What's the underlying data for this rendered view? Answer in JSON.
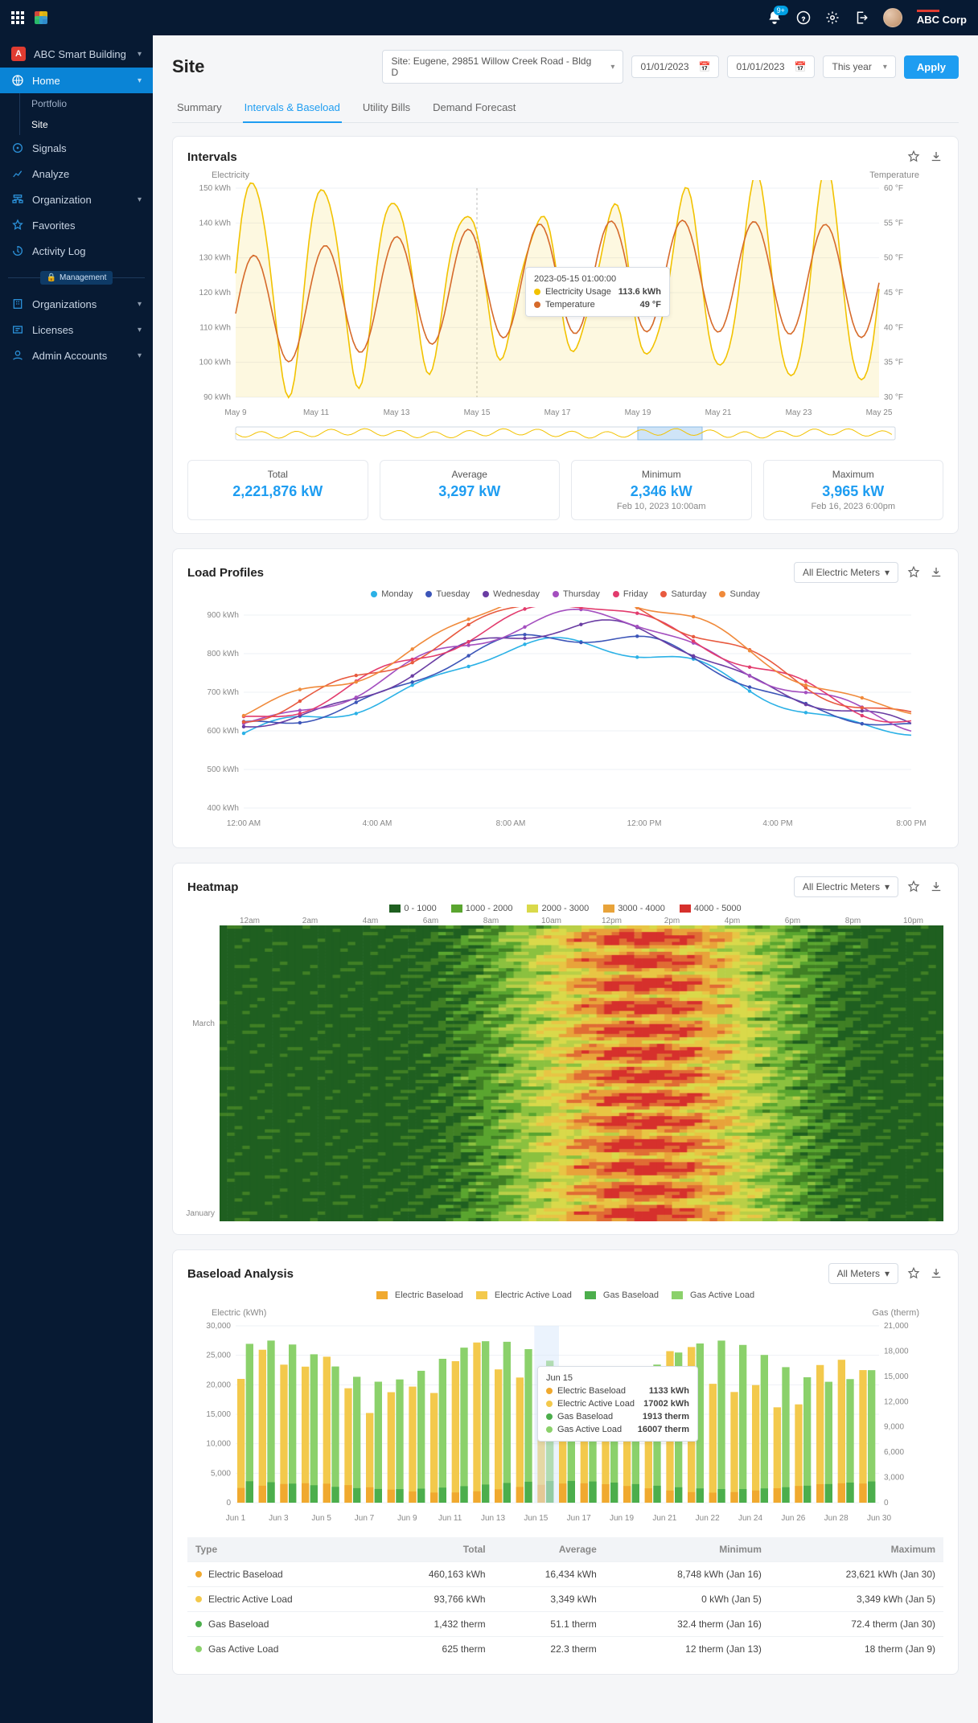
{
  "topbar": {
    "notif_badge": "9+",
    "brand": "ABC Corp"
  },
  "sidebar": {
    "app_name": "ABC Smart Building",
    "home": "Home",
    "sub_portfolio": "Portfolio",
    "sub_site": "Site",
    "signals": "Signals",
    "analyze": "Analyze",
    "organization": "Organization",
    "favorites": "Favorites",
    "activity_log": "Activity Log",
    "management_label": "Management",
    "organizations": "Organizations",
    "licenses": "Licenses",
    "admin_accounts": "Admin Accounts"
  },
  "page": {
    "title": "Site",
    "site_selector": "Site: Eugene, 29851 Willow Creek Road - Bldg D",
    "date_from": "01/01/2023",
    "date_to": "01/01/2023",
    "range": "This year",
    "apply": "Apply"
  },
  "tabs": {
    "summary": "Summary",
    "intervals": "Intervals & Baseload",
    "utility": "Utility Bills",
    "forecast": "Demand Forecast"
  },
  "intervals": {
    "title": "Intervals",
    "left_axis": "Electricity",
    "right_axis": "Temperature",
    "tooltip_time": "2023-05-15 01:00:00",
    "tooltip_elec_label": "Electricity Usage",
    "tooltip_elec_val": "113.6 kWh",
    "tooltip_temp_label": "Temperature",
    "tooltip_temp_val": "49 °F",
    "stats": {
      "total_label": "Total",
      "total_val": "2,221,876 kW",
      "avg_label": "Average",
      "avg_val": "3,297 kW",
      "min_label": "Minimum",
      "min_val": "2,346 kW",
      "min_sub": "Feb 10, 2023 10:00am",
      "max_label": "Maximum",
      "max_val": "3,965 kW",
      "max_sub": "Feb 16, 2023 6:00pm"
    }
  },
  "load_profiles": {
    "title": "Load Profiles",
    "meter_select": "All Electric Meters",
    "legend": {
      "mon": "Monday",
      "tue": "Tuesday",
      "wed": "Wednesday",
      "thu": "Thursday",
      "fri": "Friday",
      "sat": "Saturday",
      "sun": "Sunday"
    }
  },
  "heatmap": {
    "title": "Heatmap",
    "meter_select": "All Electric Meters",
    "legend": {
      "b1": "0 - 1000",
      "b2": "1000 - 2000",
      "b3": "2000 - 3000",
      "b4": "3000 - 4000",
      "b5": "4000 - 5000"
    }
  },
  "baseload": {
    "title": "Baseload Analysis",
    "meter_select": "All Meters",
    "legend": {
      "eb": "Electric Baseload",
      "ea": "Electric Active Load",
      "gb": "Gas Baseload",
      "ga": "Gas Active Load"
    },
    "left_axis": "Electric (kWh)",
    "right_axis": "Gas (therm)",
    "tooltip": {
      "date": "Jun 15",
      "eb_label": "Electric Baseload",
      "eb_val": "1133 kWh",
      "ea_label": "Electric Active Load",
      "ea_val": "17002 kWh",
      "gb_label": "Gas Baseload",
      "gb_val": "1913 therm",
      "ga_label": "Gas Active Load",
      "ga_val": "16007 therm"
    },
    "table": {
      "h_type": "Type",
      "h_total": "Total",
      "h_avg": "Average",
      "h_min": "Minimum",
      "h_max": "Maximum",
      "rows": [
        {
          "type": "Electric Baseload",
          "total": "460,163 kWh",
          "avg": "16,434 kWh",
          "min": "8,748 kWh (Jan 16)",
          "max": "23,621 kWh (Jan 30)",
          "color": "#f0a92f"
        },
        {
          "type": "Electric Active Load",
          "total": "93,766 kWh",
          "avg": "3,349 kWh",
          "min": "0 kWh (Jan 5)",
          "max": "3,349 kWh (Jan 5)",
          "color": "#f3c94c"
        },
        {
          "type": "Gas Baseload",
          "total": "1,432 therm",
          "avg": "51.1 therm",
          "min": "32.4 therm (Jan 16)",
          "max": "72.4 therm (Jan 30)",
          "color": "#4cae4c"
        },
        {
          "type": "Gas Active Load",
          "total": "625 therm",
          "avg": "22.3 therm",
          "min": "12 therm (Jan 13)",
          "max": "18 therm (Jan 9)",
          "color": "#8bd16b"
        }
      ]
    }
  },
  "chart_data": [
    {
      "id": "intervals",
      "type": "line",
      "x_ticks": [
        "May 9",
        "May 11",
        "May 13",
        "May 15",
        "May 17",
        "May 19",
        "May 21",
        "May 23",
        "May 25"
      ],
      "y_left_ticks": [
        90,
        100,
        110,
        120,
        130,
        140,
        150
      ],
      "y_left_unit": "kWh",
      "y_right_ticks": [
        30,
        35,
        40,
        45,
        50,
        55,
        60
      ],
      "y_right_unit": "°F",
      "series": [
        {
          "name": "Electricity Usage",
          "color": "#f2c200",
          "approx_range": [
            95,
            150
          ]
        },
        {
          "name": "Temperature",
          "color": "#d66a2a",
          "approx_range": [
            38,
            56
          ]
        }
      ]
    },
    {
      "id": "load_profiles",
      "type": "line",
      "x_ticks": [
        "12:00 AM",
        "4:00 AM",
        "8:00 AM",
        "12:00 PM",
        "4:00 PM",
        "8:00 PM"
      ],
      "y_ticks": [
        400,
        500,
        600,
        700,
        800,
        900
      ],
      "y_unit": "kWh",
      "series_colors": {
        "Monday": "#2bb1e6",
        "Tuesday": "#3c55b8",
        "Wednesday": "#6a3da3",
        "Thursday": "#a44fbf",
        "Friday": "#e23b6d",
        "Saturday": "#e85a3f",
        "Sunday": "#f08a3b"
      },
      "approx_peak_range": [
        800,
        880
      ],
      "approx_night_range": [
        560,
        650
      ]
    },
    {
      "id": "heatmap",
      "type": "heatmap",
      "x_ticks": [
        "12am",
        "2am",
        "4am",
        "6am",
        "8am",
        "10am",
        "12pm",
        "2pm",
        "4pm",
        "6pm",
        "8pm",
        "10pm"
      ],
      "y_range": [
        "January",
        "March"
      ],
      "bins": [
        {
          "label": "0 - 1000",
          "color": "#1f5f20"
        },
        {
          "label": "1000 - 2000",
          "color": "#5aa52f"
        },
        {
          "label": "2000 - 3000",
          "color": "#d9d94a"
        },
        {
          "label": "3000 - 4000",
          "color": "#e8a33a"
        },
        {
          "label": "4000 - 5000",
          "color": "#d6302c"
        }
      ]
    },
    {
      "id": "baseload",
      "type": "bar",
      "x_ticks": [
        "Jun 1",
        "Jun 3",
        "Jun 5",
        "Jun 7",
        "Jun 9",
        "Jun 11",
        "Jun 13",
        "Jun 15",
        "Jun 17",
        "Jun 19",
        "Jun 21",
        "Jun 22",
        "Jun 24",
        "Jun 26",
        "Jun 28",
        "Jun 30"
      ],
      "y_left_ticks": [
        0,
        5000,
        10000,
        15000,
        20000,
        25000,
        30000
      ],
      "y_right_ticks": [
        0,
        3000,
        6000,
        9000,
        12000,
        15000,
        18000,
        21000
      ],
      "series": [
        {
          "name": "Electric Baseload",
          "color": "#f0a92f"
        },
        {
          "name": "Electric Active Load",
          "color": "#f3c94c"
        },
        {
          "name": "Gas Baseload",
          "color": "#4cae4c"
        },
        {
          "name": "Gas Active Load",
          "color": "#8bd16b"
        }
      ]
    }
  ]
}
